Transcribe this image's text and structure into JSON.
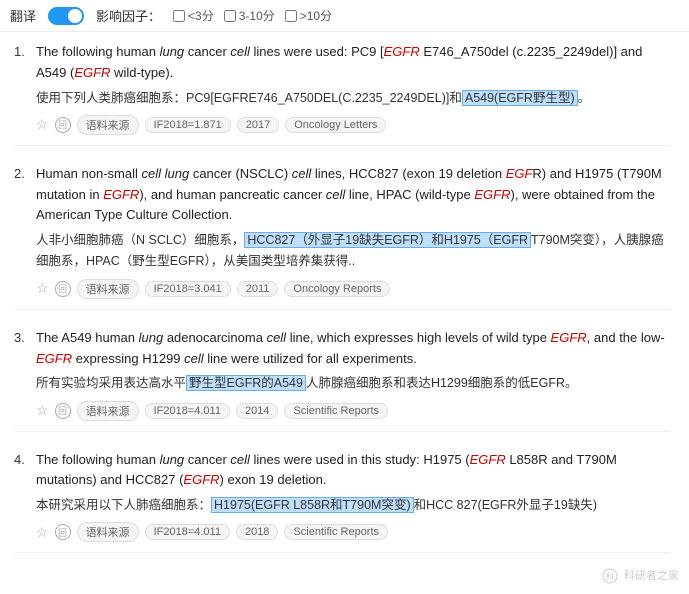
{
  "topbar": {
    "translate_label": "翻译",
    "factor_label": "影响因子：",
    "options": [
      {
        "label": "<3分",
        "checked": false
      },
      {
        "label": "3-10分",
        "checked": false
      },
      {
        "label": ">10分",
        "checked": false
      }
    ]
  },
  "results": [
    {
      "index": "1.",
      "en_text_parts": [
        {
          "text": "The following human "
        },
        {
          "text": "lung",
          "style": "italic"
        },
        {
          "text": " cancer "
        },
        {
          "text": "cell",
          "style": "italic"
        },
        {
          "text": " lines were used: PC9 ["
        },
        {
          "text": "EGFR",
          "style": "red-italic"
        },
        {
          "text": " E746_A750del (c.2235_2249del)] and A549 ("
        },
        {
          "text": "EGFR",
          "style": "red-italic"
        },
        {
          "text": " wild-type)."
        }
      ],
      "zh_text": "使用下列人类肺癌细胞系：PC9[EGFRE746_A750DEL(C.2235_2249DEL)]和",
      "zh_highlight": "A549(EGFR野生型)。",
      "if_value": "IF2018=1.871",
      "year": "2017",
      "journal": "Oncology Letters"
    },
    {
      "index": "2.",
      "en_text_parts": [
        {
          "text": "Human non-small "
        },
        {
          "text": "cell lung",
          "style": "italic"
        },
        {
          "text": " cancer (NSCLC) "
        },
        {
          "text": "cell",
          "style": "italic"
        },
        {
          "text": " lines, HCC827 (exon 19 deletion "
        },
        {
          "text": "EGF",
          "style": "red-italic"
        },
        {
          "text": "\nR) and H1975 (T790M mutation in "
        },
        {
          "text": "EGFR",
          "style": "red-italic"
        },
        {
          "text": "), and human pancreatic cancer "
        },
        {
          "text": "cell",
          "style": "italic"
        },
        {
          "text": " line, HPAC (wild-type "
        },
        {
          "text": "EGFR",
          "style": "red-italic"
        },
        {
          "text": "), were obtained from the American Type Culture Collection."
        }
      ],
      "zh_text_parts": [
        {
          "text": "人非小细胞肺癌（N SCLC）细胞系，"
        },
        {
          "text": "HCC827（外显子19缺失EGFR）和H1975（EGFR",
          "style": "highlight"
        },
        {
          "text": "T790M突\n变），人胰腺癌细胞系，HPAC（野生型EGFR），从美国类型培养集获得.."
        }
      ],
      "if_value": "IF2018=3.041",
      "year": "2011",
      "journal": "Oncology Reports"
    },
    {
      "index": "3.",
      "en_text_parts": [
        {
          "text": "The A549 human "
        },
        {
          "text": "lung",
          "style": "italic"
        },
        {
          "text": " adenocarcinoma "
        },
        {
          "text": "cell",
          "style": "italic"
        },
        {
          "text": " line, which expresses high levels of wild type "
        },
        {
          "text": "EGFR",
          "style": "red-italic"
        },
        {
          "text": ", and the low-"
        },
        {
          "text": "EGFR",
          "style": "red-italic"
        },
        {
          "text": " expressing H1299 "
        },
        {
          "text": "cell",
          "style": "italic"
        },
        {
          "text": " line were utilized for all experiments."
        }
      ],
      "zh_text_parts": [
        {
          "text": "所有实验均采用表达高水平"
        },
        {
          "text": "野生型EGFR的A549",
          "style": "highlight"
        },
        {
          "text": "人肺腺癌细胞系和表达H1299细胞系的低EGFR。"
        }
      ],
      "if_value": "IF2018=4.011",
      "year": "2014",
      "journal": "Scientific Reports"
    },
    {
      "index": "4.",
      "en_text_parts": [
        {
          "text": "The following human "
        },
        {
          "text": "lung",
          "style": "italic"
        },
        {
          "text": " cancer "
        },
        {
          "text": "cell",
          "style": "italic"
        },
        {
          "text": " lines were used in this study: H1975 ("
        },
        {
          "text": "EGFR",
          "style": "red-italic"
        },
        {
          "text": " L858R and T790M mutations) and HCC827 ("
        },
        {
          "text": "EGFR",
          "style": "red-italic"
        },
        {
          "text": ") exon 19 deletion."
        }
      ],
      "zh_text": "本研究采用以下人肺癌细胞系：",
      "zh_highlight": "H1975(EGFR L858R和T790M突变)",
      "zh_text2": "和HCC 827(EGFR外显子19缺失)",
      "if_value": "IF2018=4.011",
      "year": "2018",
      "journal": "Scientific Reports"
    }
  ],
  "meta": {
    "source_label": "语料来源",
    "watermark": "科研者之家"
  }
}
